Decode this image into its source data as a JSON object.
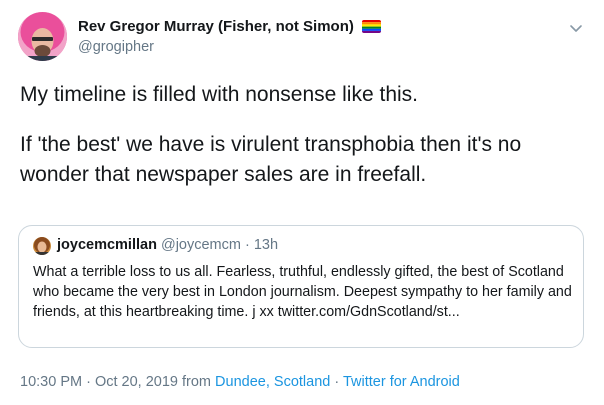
{
  "author": {
    "display_name": "Rev Gregor Murray (Fisher, not Simon)",
    "handle": "@grogipher",
    "flag_icon": "rainbow-flag-icon"
  },
  "tweet": {
    "paragraphs": [
      "My timeline is filled with nonsense like this.",
      "If 'the best' we have is virulent transphobia then it's no wonder that newspaper sales are in freefall."
    ]
  },
  "quoted_tweet": {
    "display_name": "joycemcmillan",
    "handle": "@joycemcm",
    "separator": "·",
    "time": "13h",
    "text": "What a terrible loss to us all. Fearless, truthful, endlessly gifted, the best of Scotland who became the very best in London journalism. Deepest sympathy to her family and friends, at this heartbreaking time.  j xx twitter.com/GdnScotland/st..."
  },
  "footer": {
    "timestamp": "10:30 PM · Oct 20, 2019",
    "from_label": "from",
    "location": "Dundee, Scotland",
    "separator": "·",
    "source": "Twitter for Android"
  },
  "colors": {
    "text_primary": "#14171a",
    "text_secondary": "#657786",
    "link": "#1b95e0",
    "border": "#ccd6dd"
  }
}
